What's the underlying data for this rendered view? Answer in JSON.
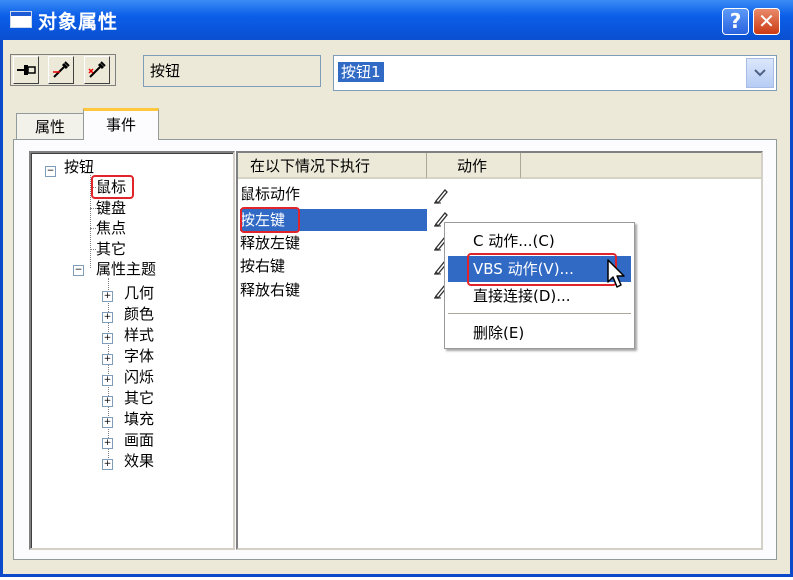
{
  "window": {
    "title": "对象属性",
    "help_label": "?",
    "close_label": "✕"
  },
  "toolbar": {
    "buttons": [
      "pin-icon",
      "dropper-icon",
      "dropper-clear-icon"
    ],
    "object_type": "按钮",
    "object_name": "按钮1"
  },
  "tabs": [
    {
      "label": "属性",
      "selected": false
    },
    {
      "label": "事件",
      "selected": true
    }
  ],
  "tree": {
    "root": "按钮",
    "children": [
      "鼠标",
      "键盘",
      "焦点",
      "其它",
      "属性主题"
    ],
    "property_themes": [
      "几何",
      "颜色",
      "样式",
      "字体",
      "闪烁",
      "其它",
      "填充",
      "画面",
      "效果"
    ],
    "highlighted": "鼠标"
  },
  "events": {
    "columns": [
      "在以下情况下执行",
      "动作"
    ],
    "rows": [
      "鼠标动作",
      "按左键",
      "释放左键",
      "按右键",
      "释放右键"
    ],
    "selected": "按左键"
  },
  "context_menu": {
    "items": [
      "C 动作...(C)",
      "VBS 动作(V)...",
      "直接连接(D)...",
      "删除(E)"
    ],
    "hovered": "VBS 动作(V)..."
  },
  "colors": {
    "titlebar": "#0b5ee8",
    "selection": "#316ac5",
    "highlight_outline": "#e0242a",
    "tab_accent": "#ffc73c"
  }
}
